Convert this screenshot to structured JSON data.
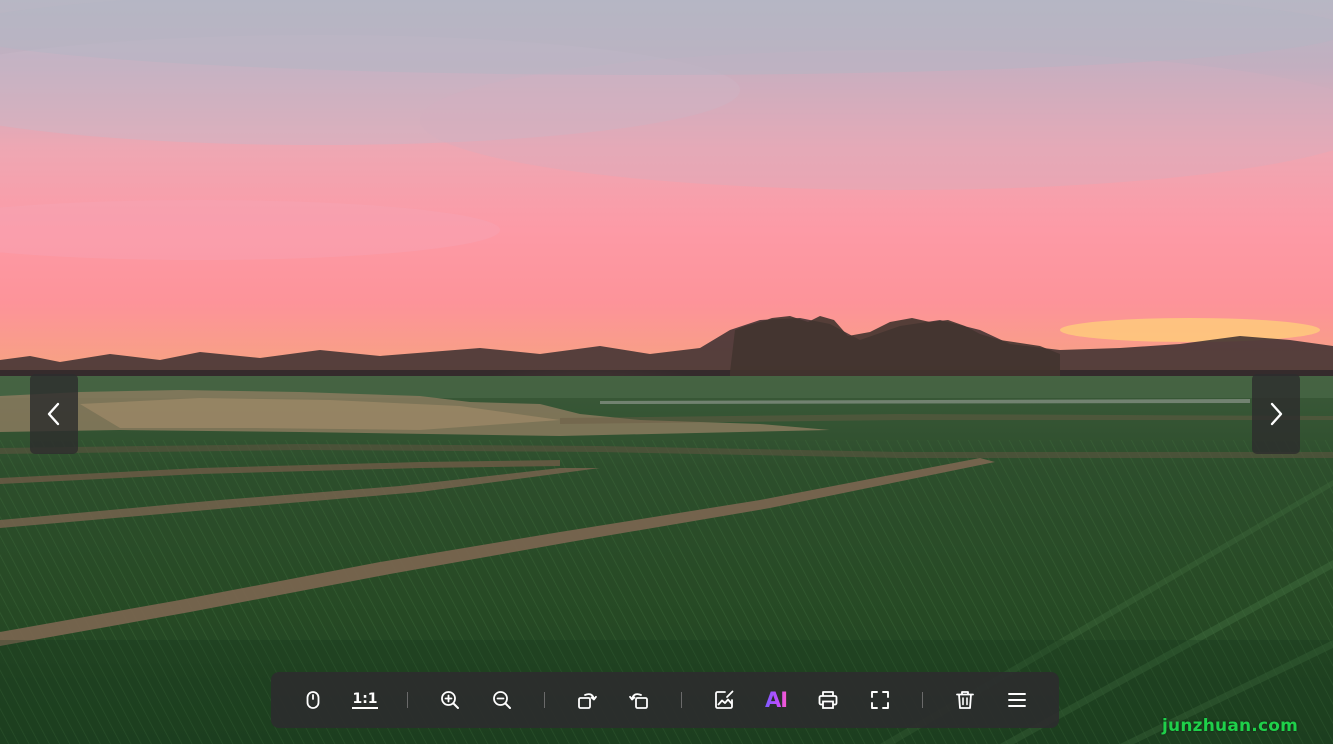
{
  "viewer": {
    "toolbar": {
      "actual_size_label": "1:1",
      "ai_label": "AI",
      "ai_gradient": [
        "#7b5cff",
        "#ff5cc8"
      ]
    },
    "watermark": "junzhuan.com",
    "watermark_color": "#1fd04a",
    "icons": {
      "prev": "chevron-left-icon",
      "next": "chevron-right-icon",
      "mouse": "mouse-icon",
      "zoom_in": "zoom-in-icon",
      "zoom_out": "zoom-out-icon",
      "rotate_right": "rotate-right-icon",
      "rotate_left": "rotate-left-icon",
      "edit_image": "edit-image-icon",
      "print": "print-icon",
      "fullscreen": "fullscreen-icon",
      "delete": "trash-icon",
      "menu": "menu-icon"
    }
  }
}
